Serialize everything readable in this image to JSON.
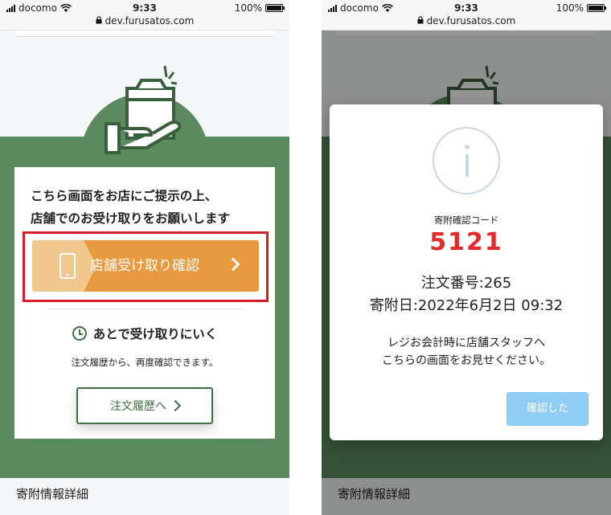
{
  "status_bar": {
    "carrier": "docomo",
    "time": "9:33",
    "url": "dev.furusatos.com",
    "battery": "100%"
  },
  "left_screen": {
    "instruction_line1": "こちら画面をお店にご提示の上、",
    "instruction_line2": "店舗でのお受け取りをお願いします",
    "confirm_button": "店舗受け取り確認",
    "later_heading": "あとで受け取りにいく",
    "later_note": "注文履歴から、再度確認できます。",
    "history_button": "注文履歴へ",
    "details_heading": "寄附情報詳細"
  },
  "right_screen": {
    "modal": {
      "code_label": "寄附確認コード",
      "code_value": "5121",
      "order_number": "注文番号:265",
      "donation_date": "寄附日:2022年6月2日 09:32",
      "notice_line1": "レジお会計時に店舗スタッフへ",
      "notice_line2": "こちらの画面をお見せください。",
      "ok_button": "確認した"
    },
    "details_heading": "寄附情報詳細"
  },
  "colors": {
    "brand_green": "#5a8a5e",
    "dark_green": "#3e6e45",
    "orange": "#e79a3f",
    "highlight_red": "#d32027",
    "code_red": "#e22a2a",
    "ok_blue": "#90cdf4"
  },
  "icons": [
    "wifi-icon",
    "lock-icon",
    "battery-icon",
    "hand-bag-icon",
    "smartphone-icon",
    "chevron-right-icon",
    "clock-icon",
    "info-icon"
  ]
}
